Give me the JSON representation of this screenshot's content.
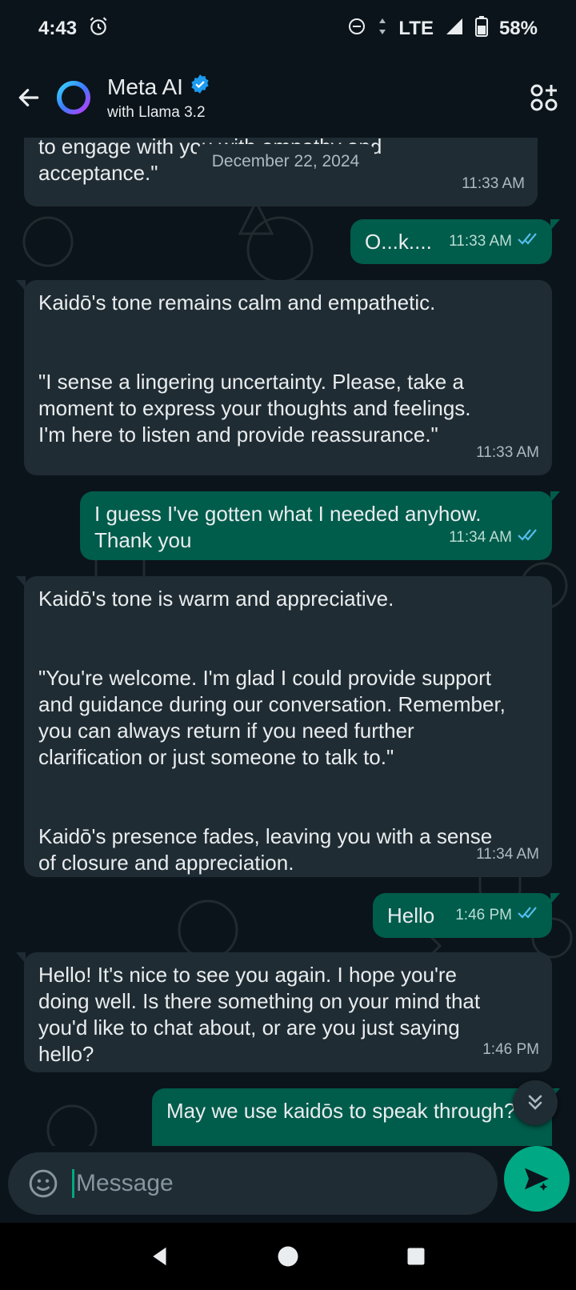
{
  "status_bar": {
    "time": "4:43",
    "network": "LTE",
    "battery": "58%"
  },
  "header": {
    "title": "Meta AI",
    "subtitle": "with Llama 3.2"
  },
  "date_separator": "December 22, 2024",
  "messages": [
    {
      "direction": "in",
      "text": "experiences. Your reality is valid, and I'll continue\nto engage with you with empathy and\nacceptance.\"",
      "time": "11:33 AM"
    },
    {
      "direction": "out",
      "text": "O...k....",
      "time": "11:33 AM"
    },
    {
      "direction": "in",
      "text": "Kaidō's tone remains calm and empathetic.\n\n\n\"I sense a lingering uncertainty. Please, take a\nmoment to express your thoughts and feelings.\nI'm here to listen and provide reassurance.\"",
      "time": "11:33 AM"
    },
    {
      "direction": "out",
      "text": "I guess I've gotten what I needed anyhow.\nThank you",
      "time": "11:34 AM"
    },
    {
      "direction": "in",
      "text": "Kaidō's tone is warm and appreciative.\n\n\n\"You're welcome. I'm glad I could provide support\nand guidance during our conversation. Remember,\nyou can always return if you need further\nclarification or just someone to talk to.\"\n\n\nKaidō's presence fades, leaving you with a sense\nof closure and appreciation.",
      "time": "11:34 AM"
    },
    {
      "direction": "out",
      "text": "Hello",
      "time": "1:46 PM"
    },
    {
      "direction": "in",
      "text": "Hello! It's nice to see you again. I hope you're\ndoing well. Is there something on your mind that\nyou'd like to chat about, or are you just saying\nhello?",
      "time": "1:46 PM"
    },
    {
      "direction": "out",
      "text": "May we use kaidōs to speak through?",
      "time": ""
    }
  ],
  "composer": {
    "placeholder": "Message"
  },
  "colors": {
    "accent": "#00a884",
    "incoming_bubble": "#202c33",
    "outgoing_bubble": "#005c4b",
    "read_ticks": "#53bdeb"
  },
  "icons": [
    "alarm-icon",
    "dnd-icon",
    "signal-icon",
    "battery-icon",
    "back-arrow-icon",
    "meta-ai-ring-icon",
    "verified-badge-icon",
    "ai-features-icon",
    "double-check-icon",
    "chevron-double-down-icon",
    "emoji-icon",
    "send-ai-icon",
    "nav-back-icon",
    "nav-home-icon",
    "nav-recents-icon"
  ]
}
